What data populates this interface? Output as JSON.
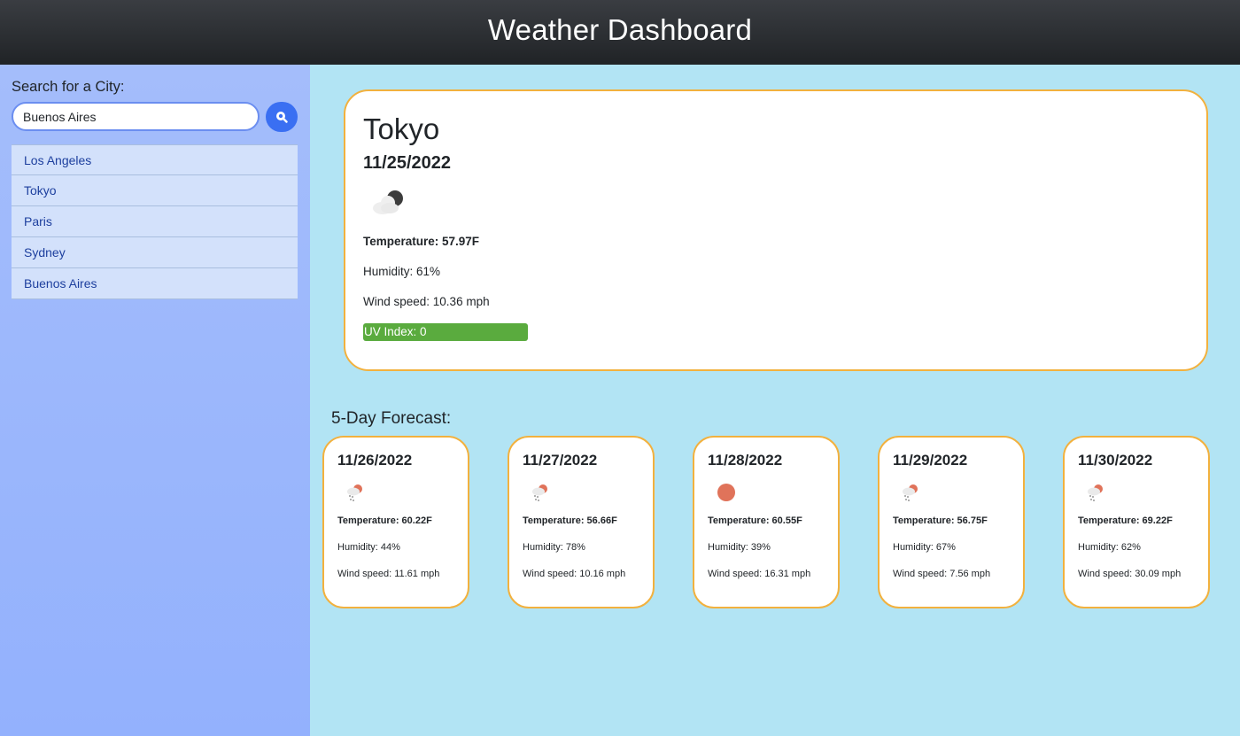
{
  "header": {
    "title": "Weather Dashboard"
  },
  "sidebar": {
    "search_label": "Search for a City:",
    "search_value": "Buenos Aires",
    "search_button_icon": "search-icon",
    "history": [
      "Los Angeles",
      "Tokyo",
      "Paris",
      "Sydney",
      "Buenos Aires"
    ]
  },
  "current": {
    "city": "Tokyo",
    "date": "11/25/2022",
    "icon": "cloud-night-icon",
    "temperature": "Temperature: 57.97F",
    "humidity": "Humidity: 61%",
    "wind": "Wind speed: 10.36 mph",
    "uv": "UV Index: 0",
    "uv_color": "#5aab3e"
  },
  "forecast": {
    "title": "5-Day Forecast:",
    "days": [
      {
        "date": "11/26/2022",
        "icon": "rain-sun-icon",
        "temperature": "Temperature: 60.22F",
        "humidity": "Humidity: 44%",
        "wind": "Wind speed: 11.61 mph"
      },
      {
        "date": "11/27/2022",
        "icon": "rain-sun-icon",
        "temperature": "Temperature: 56.66F",
        "humidity": "Humidity: 78%",
        "wind": "Wind speed: 10.16 mph"
      },
      {
        "date": "11/28/2022",
        "icon": "sun-icon",
        "temperature": "Temperature: 60.55F",
        "humidity": "Humidity: 39%",
        "wind": "Wind speed: 16.31 mph"
      },
      {
        "date": "11/29/2022",
        "icon": "rain-sun-icon",
        "temperature": "Temperature: 56.75F",
        "humidity": "Humidity: 67%",
        "wind": "Wind speed: 7.56 mph"
      },
      {
        "date": "11/30/2022",
        "icon": "rain-sun-icon",
        "temperature": "Temperature: 69.22F",
        "humidity": "Humidity: 62%",
        "wind": "Wind speed: 30.09 mph"
      }
    ]
  },
  "colors": {
    "card_border": "#f2b13e",
    "sidebar_bg": "#a4bdfb",
    "main_bg": "#b2e4f4",
    "accent": "#3a6ff2"
  }
}
